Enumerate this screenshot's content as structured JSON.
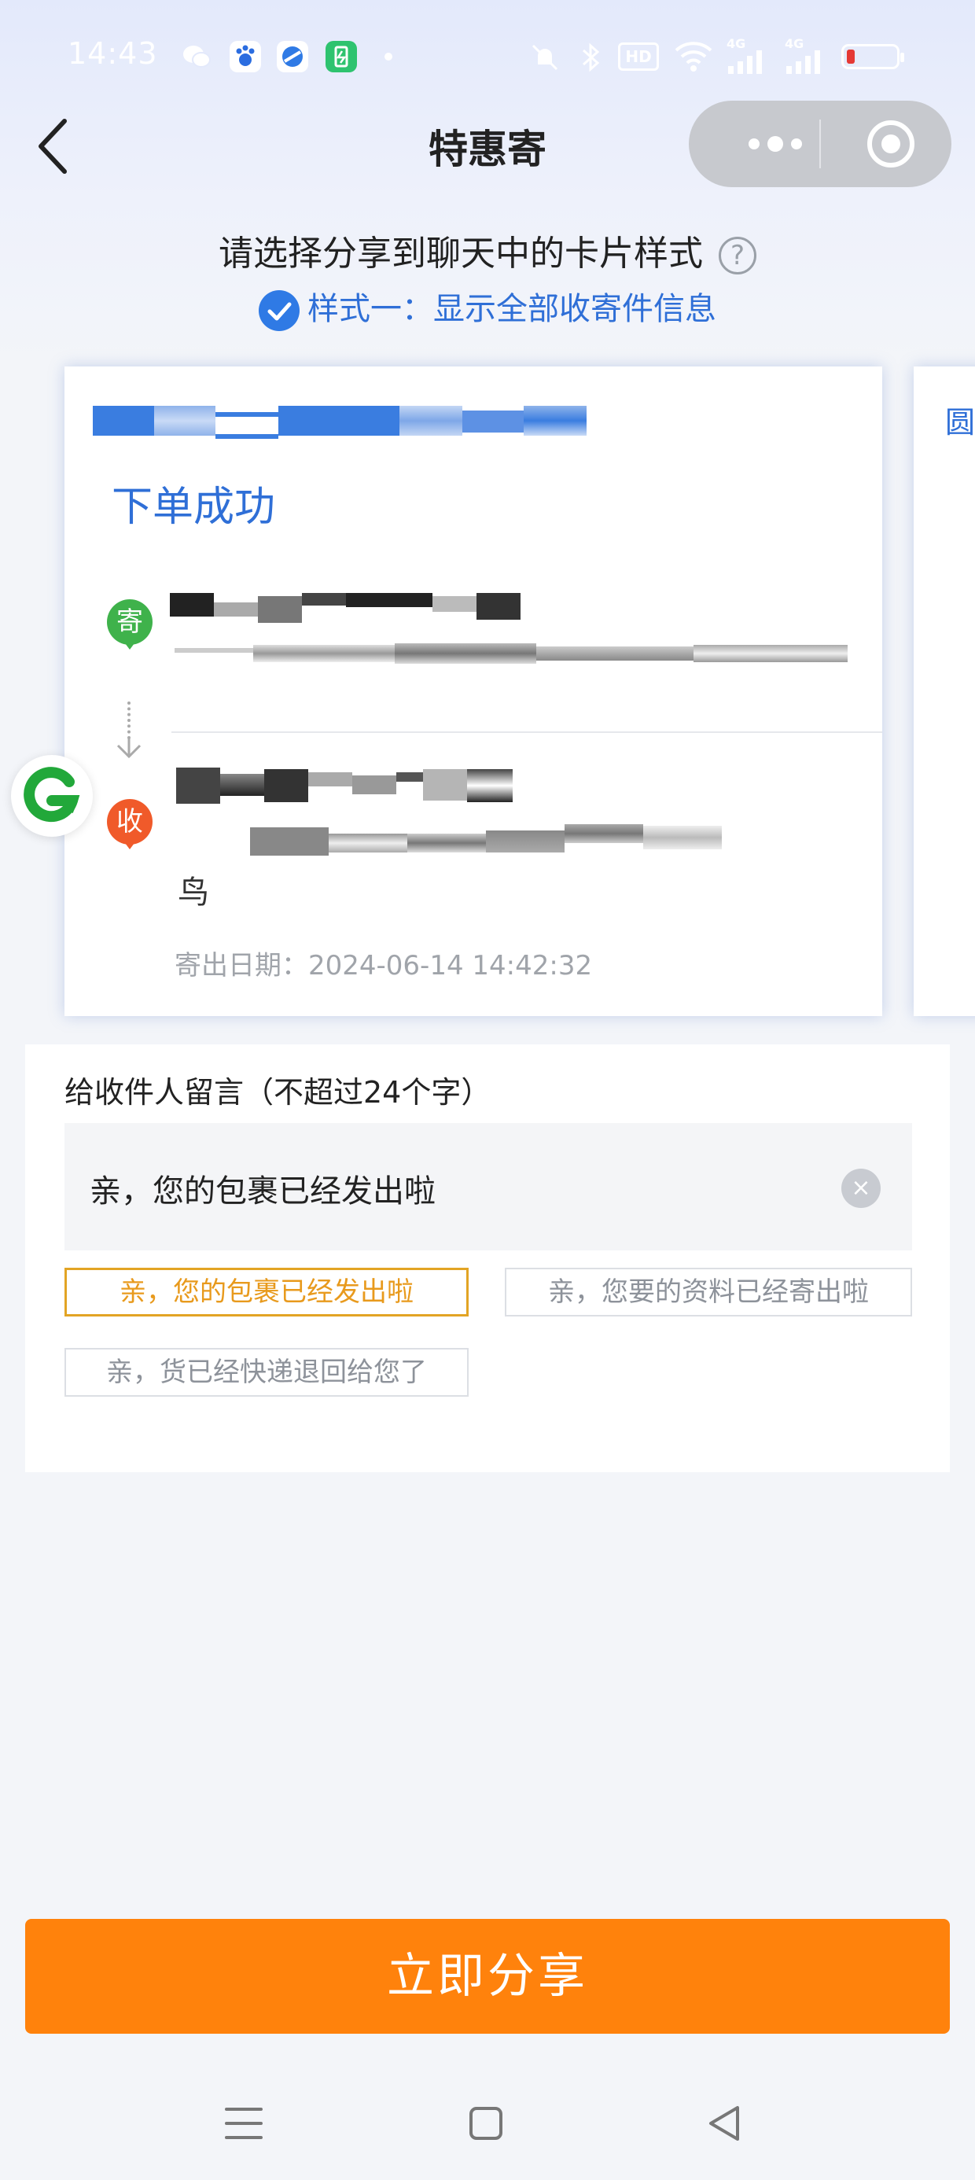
{
  "status_bar": {
    "time": "14:43",
    "hd_label": "HD",
    "network_label": "4G"
  },
  "nav": {
    "title": "特惠寄"
  },
  "header": {
    "subtitle": "请选择分享到聊天中的卡片样式",
    "help_icon": "?",
    "style_option": "样式一：显示全部收寄件信息"
  },
  "card": {
    "status": "下单成功",
    "sender_tag": "寄",
    "receiver_tag": "收",
    "receiver_extra": "鸟",
    "ship_date_label": "寄出日期：",
    "ship_date_value": "2024-06-14 14:42:32",
    "next_card_peek": "圆"
  },
  "message": {
    "label": "给收件人留言（不超过24个字）",
    "value": "亲，您的包裹已经发出啦",
    "clear_icon": "×",
    "presets": [
      "亲，您的包裹已经发出啦",
      "亲，您要的资料已经寄出啦",
      "亲，货已经快递退回给您了"
    ],
    "selected_preset_index": 0
  },
  "actions": {
    "share_label": "立即分享"
  },
  "colors": {
    "accent_blue": "#2f6fd7",
    "share_orange": "#ff820c",
    "chip_selected": "#e2a424",
    "sender_green": "#3fb24b",
    "receiver_red": "#f05a2a"
  },
  "icons": {
    "back": "back-chevron-icon",
    "more": "more-dots-icon",
    "close_miniprogram": "target-circle-icon",
    "floating": "green-g-logo-icon",
    "sys_menu": "menu-lines-icon",
    "sys_home": "square-home-icon",
    "sys_back": "triangle-back-icon"
  }
}
